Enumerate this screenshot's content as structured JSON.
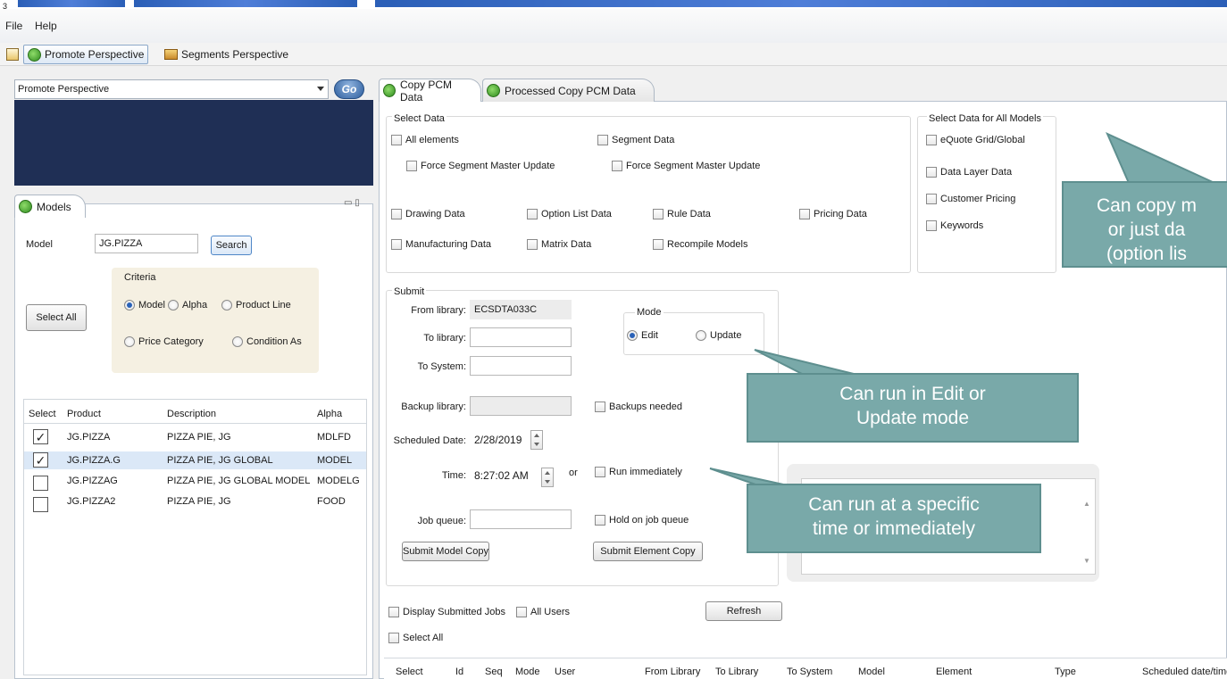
{
  "window": {
    "corner_mark": "3"
  },
  "menu": {
    "items": [
      "File",
      "Help"
    ]
  },
  "toolbar": {
    "promote_label": "Promote Perspective",
    "segments_label": "Segments Perspective"
  },
  "left": {
    "perspective_select": "Promote Perspective",
    "go_label": "Go",
    "models_tab": "Models",
    "model_label": "Model",
    "model_value": "JG.PIZZA",
    "search_label": "Search",
    "select_all_label": "Select All",
    "criteria": {
      "title": "Criteria",
      "options": [
        "Model",
        "Alpha",
        "Product Line",
        "Price Category",
        "Condition As"
      ],
      "selected": "Model"
    },
    "table": {
      "headers": [
        "Select",
        "Product",
        "Description",
        "Alpha"
      ],
      "rows": [
        {
          "checked": true,
          "product": "JG.PIZZA",
          "description": "PIZZA PIE, JG",
          "alpha": "MDLFD"
        },
        {
          "checked": true,
          "product": "JG.PIZZA.G",
          "description": "PIZZA PIE, JG GLOBAL",
          "alpha": "MODEL"
        },
        {
          "checked": false,
          "product": "JG.PIZZAG",
          "description": "PIZZA PIE, JG GLOBAL MODEL",
          "alpha": "MODELG"
        },
        {
          "checked": false,
          "product": "JG.PIZZA2",
          "description": "PIZZA PIE, JG",
          "alpha": "FOOD"
        }
      ]
    }
  },
  "tabs": [
    {
      "label": "Copy PCM Data",
      "selected": true
    },
    {
      "label": "Processed Copy PCM Data",
      "selected": false
    }
  ],
  "select_data": {
    "title": "Select Data",
    "all_elements": "All elements",
    "force_1": "Force Segment Master Update",
    "segment_data": "Segment Data",
    "force_2": "Force Segment Master Update",
    "drawing": "Drawing Data",
    "option_list": "Option List Data",
    "rule": "Rule Data",
    "pricing": "Pricing Data",
    "manufacturing": "Manufacturing Data",
    "matrix": "Matrix Data",
    "recompile": "Recompile Models"
  },
  "select_all_models": {
    "title": "Select Data for All Models",
    "items": [
      "eQuote Grid/Global",
      "Data Layer Data",
      "Customer Pricing",
      "Keywords"
    ]
  },
  "submit": {
    "title": "Submit",
    "from_label": "From library:",
    "from_value": "ECSDTA033C",
    "to_label": "To library:",
    "to_system_label": "To System:",
    "mode_title": "Mode",
    "mode_edit": "Edit",
    "mode_update": "Update",
    "backup_label": "Backup library:",
    "backups_needed": "Backups needed",
    "sched_label": "Scheduled Date:",
    "sched_value": "2/28/2019",
    "time_label": "Time:",
    "time_value": "8:27:02 AM",
    "or": "or",
    "run_immediately": "Run immediately",
    "job_queue_label": "Job queue:",
    "hold": "Hold on job queue",
    "submit_model": "Submit Model Copy",
    "submit_element": "Submit Element Copy"
  },
  "jobs": {
    "display_submitted": "Display Submitted Jobs",
    "all_users": "All Users",
    "refresh": "Refresh",
    "select_all": "Select All",
    "headers": [
      "Select",
      "Id",
      "Seq",
      "Mode",
      "User",
      "From Library",
      "To Library",
      "To System",
      "Model",
      "Element",
      "Type",
      "Scheduled date/time"
    ]
  },
  "callouts": {
    "copy": [
      "Can copy m",
      "or just da",
      "(option lis"
    ],
    "edit": [
      "Can run in Edit or",
      "Update mode"
    ],
    "time": [
      "Can run at a specific",
      "time or immediately"
    ]
  }
}
